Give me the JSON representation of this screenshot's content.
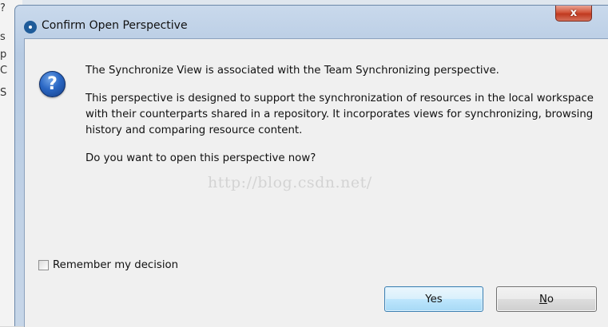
{
  "background": {
    "fragments": [
      "?",
      "s",
      "p",
      "C",
      "S"
    ]
  },
  "dialog": {
    "title": "Confirm Open Perspective",
    "close_label": "x",
    "icon": "question-icon",
    "icon_glyph": "?",
    "message": {
      "line1": "The Synchronize View is associated with the Team Synchronizing perspective.",
      "line2": "This perspective is designed to support the synchronization of resources in the local workspace with their counterparts shared in a repository. It incorporates views for synchronizing, browsing history and comparing resource content.",
      "line3": "Do you want to open this perspective now?"
    },
    "watermark": "http://blog.csdn.net/",
    "remember": {
      "label": "Remember my decision",
      "checked": false
    },
    "buttons": {
      "yes_label": "Yes",
      "no_mnemonic": "N",
      "no_rest": "o"
    }
  },
  "colors": {
    "accent": "#3c7fb1",
    "close": "#c03920",
    "question_icon": "#2a67c4"
  }
}
